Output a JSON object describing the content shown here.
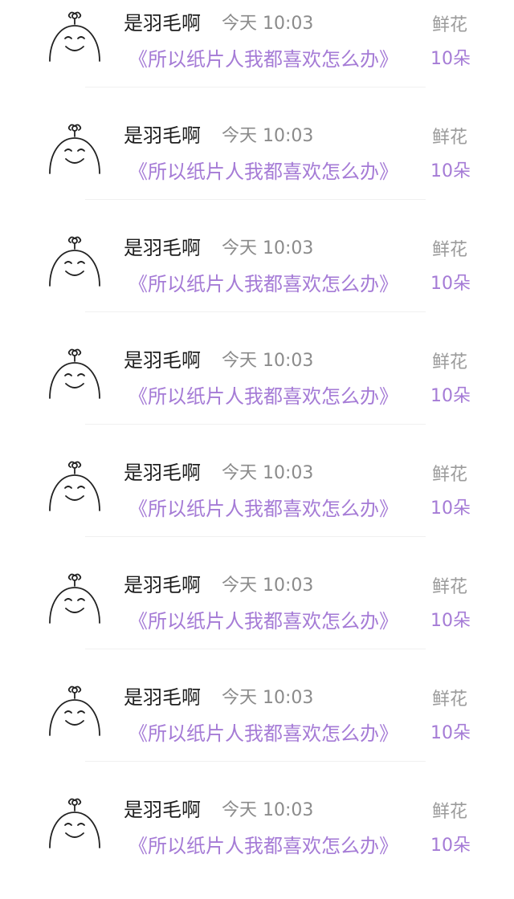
{
  "colors": {
    "accent": "#a57bd6",
    "name": "#1e1e1e",
    "meta": "#8b8b8b"
  },
  "records": [
    {
      "name": "是羽毛啊",
      "time": "今天 10:03",
      "title": "《所以纸片人我都喜欢怎么办》",
      "gift_label": "鲜花",
      "gift_count": "10朵",
      "avatar_icon": "doodle-face-sprout-icon"
    },
    {
      "name": "是羽毛啊",
      "time": "今天 10:03",
      "title": "《所以纸片人我都喜欢怎么办》",
      "gift_label": "鲜花",
      "gift_count": "10朵",
      "avatar_icon": "doodle-face-sprout-icon"
    },
    {
      "name": "是羽毛啊",
      "time": "今天 10:03",
      "title": "《所以纸片人我都喜欢怎么办》",
      "gift_label": "鲜花",
      "gift_count": "10朵",
      "avatar_icon": "doodle-face-sprout-icon"
    },
    {
      "name": "是羽毛啊",
      "time": "今天 10:03",
      "title": "《所以纸片人我都喜欢怎么办》",
      "gift_label": "鲜花",
      "gift_count": "10朵",
      "avatar_icon": "doodle-face-sprout-icon"
    },
    {
      "name": "是羽毛啊",
      "time": "今天 10:03",
      "title": "《所以纸片人我都喜欢怎么办》",
      "gift_label": "鲜花",
      "gift_count": "10朵",
      "avatar_icon": "doodle-face-sprout-icon"
    },
    {
      "name": "是羽毛啊",
      "time": "今天 10:03",
      "title": "《所以纸片人我都喜欢怎么办》",
      "gift_label": "鲜花",
      "gift_count": "10朵",
      "avatar_icon": "doodle-face-sprout-icon"
    },
    {
      "name": "是羽毛啊",
      "time": "今天 10:03",
      "title": "《所以纸片人我都喜欢怎么办》",
      "gift_label": "鲜花",
      "gift_count": "10朵",
      "avatar_icon": "doodle-face-sprout-icon"
    },
    {
      "name": "是羽毛啊",
      "time": "今天 10:03",
      "title": "《所以纸片人我都喜欢怎么办》",
      "gift_label": "鲜花",
      "gift_count": "10朵",
      "avatar_icon": "doodle-face-sprout-icon"
    }
  ]
}
